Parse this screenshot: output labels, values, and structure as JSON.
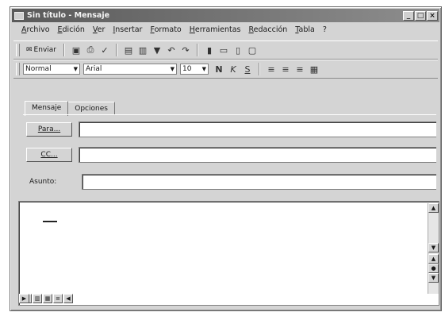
{
  "window": {
    "title": "Sin título - Mensaje"
  },
  "window_buttons": {
    "minimize": "_",
    "maximize": "□",
    "close": "×"
  },
  "menu": [
    "Archivo",
    "Edición",
    "Ver",
    "Insertar",
    "Formato",
    "Herramientas",
    "Redacción",
    "Tabla",
    "?"
  ],
  "toolbar": {
    "send_label": "Enviar"
  },
  "formatting": {
    "style": "Normal",
    "font": "Arial",
    "size": "10",
    "bold": "N",
    "italic": "K",
    "underline": "S"
  },
  "tabs": [
    "Mensaje",
    "Opciones"
  ],
  "fields": {
    "to_button": "Para...",
    "cc_button": "CC...",
    "subject_label": "Asunto:"
  },
  "icons": {
    "send": "send-icon",
    "save": "save-icon",
    "print": "print-icon",
    "spell": "spellcheck-icon"
  }
}
